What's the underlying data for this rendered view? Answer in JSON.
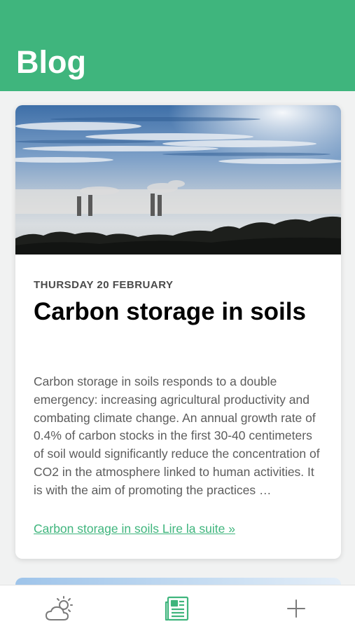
{
  "header": {
    "title": "Blog"
  },
  "post": {
    "date": "THURSDAY 20 FEBRUARY",
    "title": "Carbon storage in soils",
    "excerpt": "Carbon storage in soils responds to a double emergency: increasing agricultural productivity and combating climate change. An annual growth rate of 0.4% of carbon stocks in the first 30-40 centimeters of soil would significantly reduce the concentration of CO2 in the atmosphere linked to human activities. It is with the aim of promoting the practices …",
    "link_text": "Carbon storage in soils Lire la suite »"
  },
  "tabs": [
    {
      "icon": "weather-cloud-sun-icon",
      "active": false
    },
    {
      "icon": "newspaper-icon",
      "active": true
    },
    {
      "icon": "plus-icon",
      "active": false
    }
  ],
  "colors": {
    "accent": "#3fb57d",
    "icon_inactive": "#7a7a7a"
  }
}
